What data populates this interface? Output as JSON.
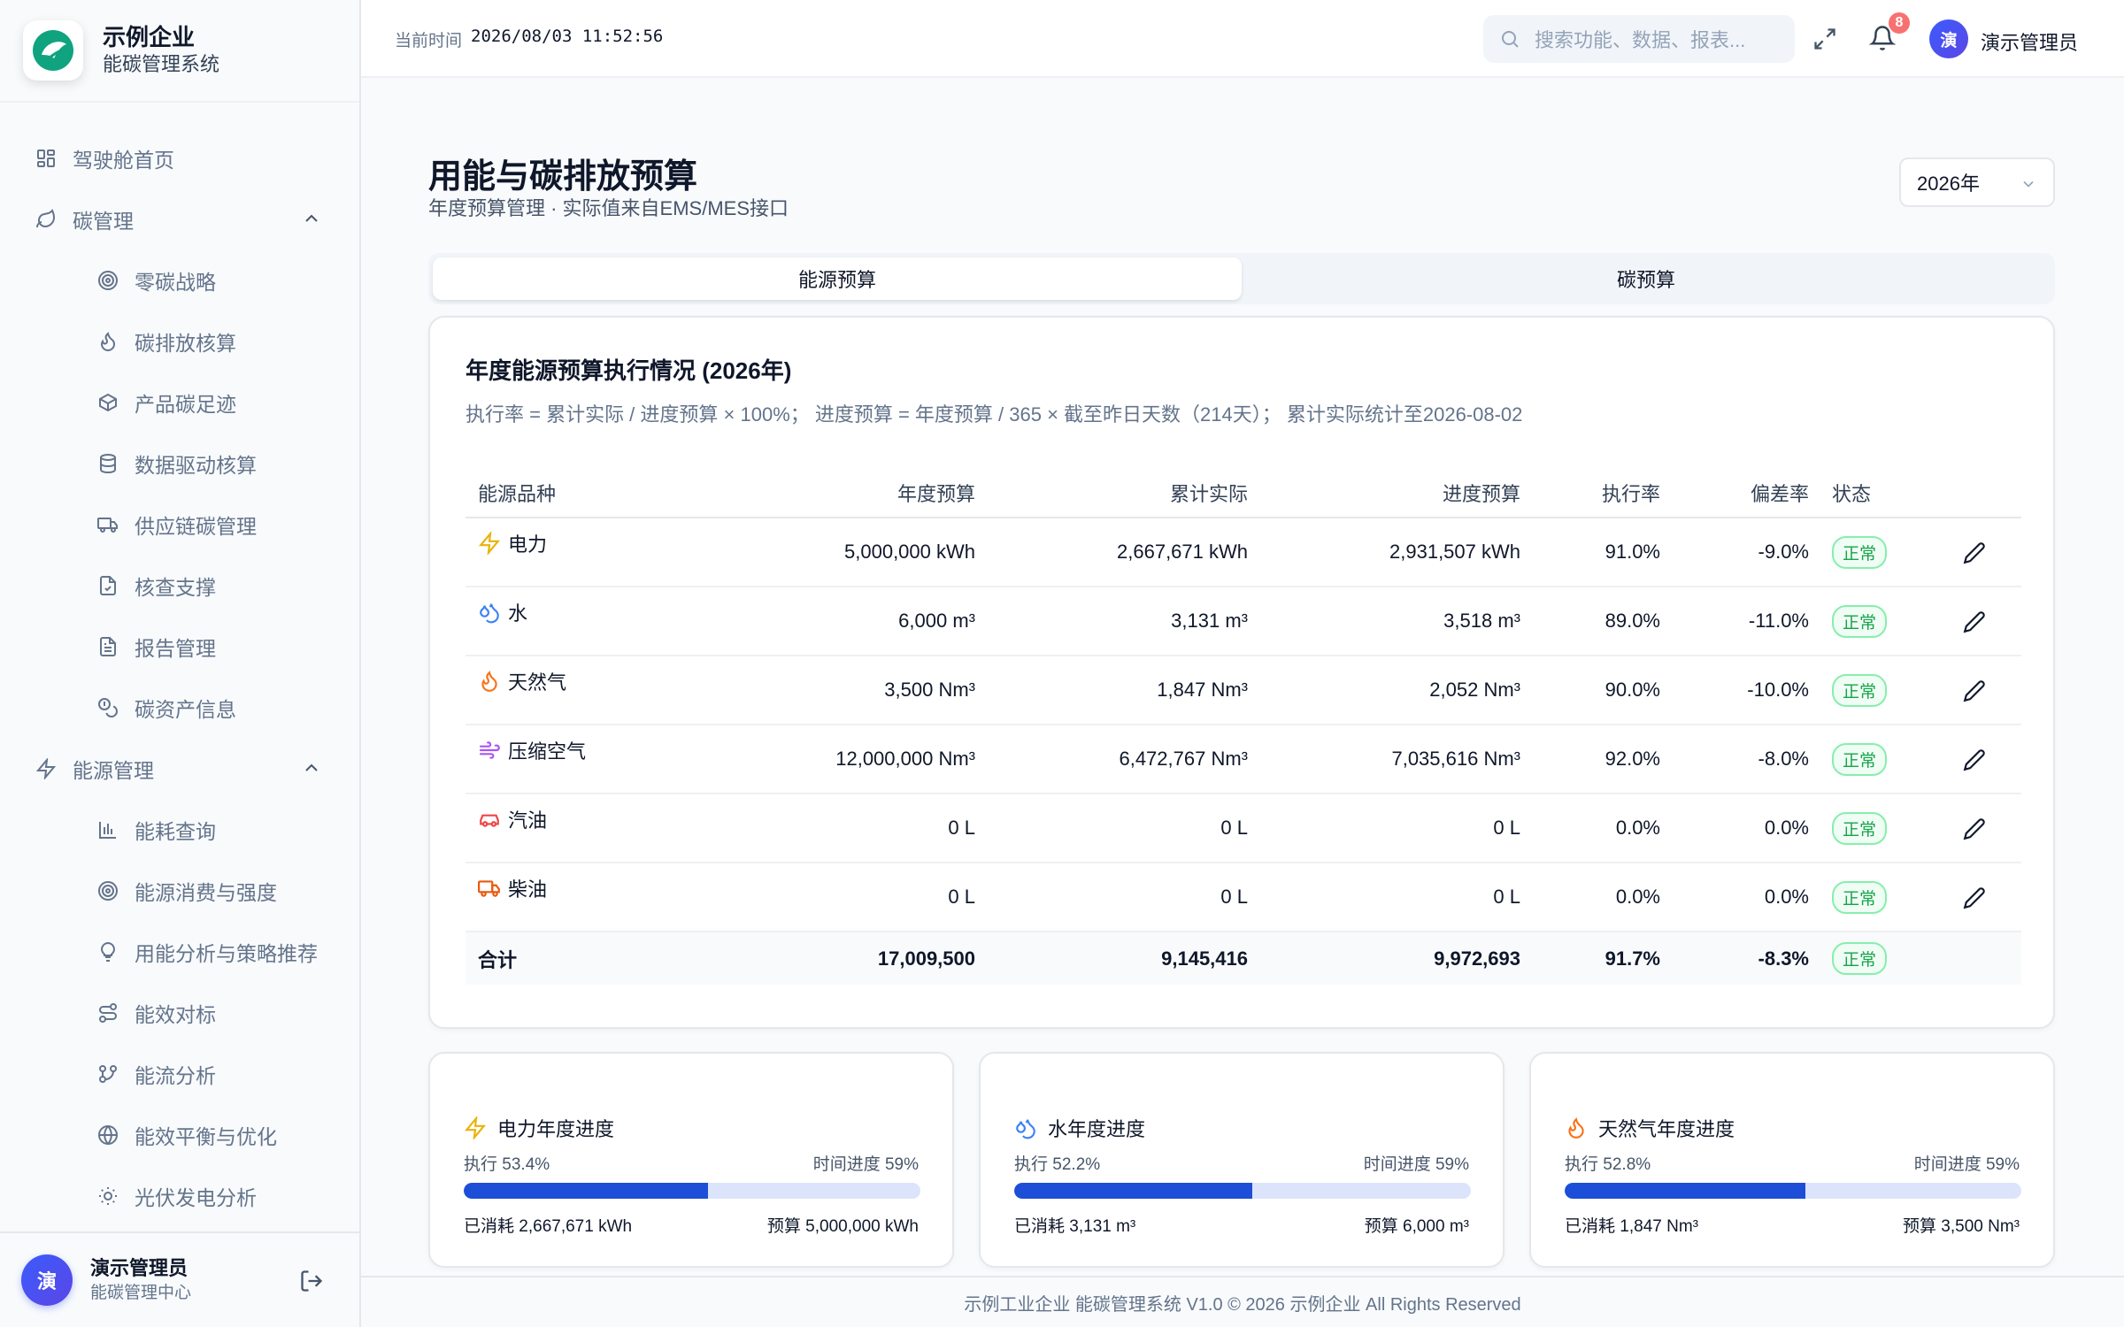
{
  "brand": {
    "name": "示例企业",
    "subtitle": "能碳管理系统"
  },
  "sidebar": {
    "home": "驾驶舱首页",
    "carbon_group": "碳管理",
    "carbon_items": [
      "零碳战略",
      "碳排放核算",
      "产品碳足迹",
      "数据驱动核算",
      "供应链碳管理",
      "核查支撑",
      "报告管理",
      "碳资产信息"
    ],
    "energy_group": "能源管理",
    "energy_items": [
      "能耗查询",
      "能源消费与强度",
      "用能分析与策略推荐",
      "能效对标",
      "能流分析",
      "能效平衡与优化",
      "光伏发电分析"
    ],
    "user": {
      "avatar": "演",
      "name": "演示管理员",
      "role": "能碳管理中心"
    }
  },
  "topbar": {
    "time_label": "当前时间",
    "time_value": "2026/08/03 11:52:56",
    "search_placeholder": "搜索功能、数据、报表...",
    "notifications": "8",
    "avatar": "演",
    "user": "演示管理员"
  },
  "page": {
    "title": "用能与碳排放预算",
    "subtitle": "年度预算管理 · 实际值来自EMS/MES接口",
    "year": "2026年"
  },
  "tabs": [
    "能源预算",
    "碳预算"
  ],
  "budget": {
    "title": "年度能源预算执行情况 (2026年)",
    "formula": "执行率 = 累计实际 / 进度预算 × 100%； 进度预算 = 年度预算 / 365 × 截至昨日天数（214天）； 累计实际统计至2026-08-02",
    "headers": [
      "能源品种",
      "年度预算",
      "累计实际",
      "进度预算",
      "执行率",
      "偏差率",
      "状态"
    ],
    "rows": [
      {
        "name": "电力",
        "icon": "lightning-icon",
        "budget": "5,000,000 kWh",
        "actual": "2,667,671 kWh",
        "progress": "2,931,507 kWh",
        "rate": "91.0%",
        "dev": "-9.0%",
        "status": "正常"
      },
      {
        "name": "水",
        "icon": "droplets-icon",
        "budget": "6,000 m³",
        "actual": "3,131 m³",
        "progress": "3,518 m³",
        "rate": "89.0%",
        "dev": "-11.0%",
        "status": "正常"
      },
      {
        "name": "天然气",
        "icon": "flame-icon",
        "budget": "3,500 Nm³",
        "actual": "1,847 Nm³",
        "progress": "2,052 Nm³",
        "rate": "90.0%",
        "dev": "-10.0%",
        "status": "正常"
      },
      {
        "name": "压缩空气",
        "icon": "wind-icon",
        "budget": "12,000,000 Nm³",
        "actual": "6,472,767 Nm³",
        "progress": "7,035,616 Nm³",
        "rate": "92.0%",
        "dev": "-8.0%",
        "status": "正常"
      },
      {
        "name": "汽油",
        "icon": "car-icon",
        "budget": "0 L",
        "actual": "0 L",
        "progress": "0 L",
        "rate": "0.0%",
        "dev": "0.0%",
        "status": "正常"
      },
      {
        "name": "柴油",
        "icon": "truck-icon",
        "budget": "0 L",
        "actual": "0 L",
        "progress": "0 L",
        "rate": "0.0%",
        "dev": "0.0%",
        "status": "正常"
      }
    ],
    "total": {
      "label": "合计",
      "budget": "17,009,500",
      "actual": "9,145,416",
      "progress": "9,972,693",
      "rate": "91.7%",
      "dev": "-8.3%",
      "status": "正常"
    }
  },
  "progress_cards": [
    {
      "title": "电力年度进度",
      "icon": "lightning-icon",
      "exec": "执行 53.4%",
      "exec_fraction": 0.534,
      "time": "时间进度 59%",
      "used": "已消耗 2,667,671 kWh",
      "budget": "预算 5,000,000 kWh"
    },
    {
      "title": "水年度进度",
      "icon": "droplets-icon",
      "exec": "执行 52.2%",
      "exec_fraction": 0.522,
      "time": "时间进度 59%",
      "used": "已消耗 3,131 m³",
      "budget": "预算 6,000 m³"
    },
    {
      "title": "天然气年度进度",
      "icon": "flame-icon",
      "exec": "执行 52.8%",
      "exec_fraction": 0.528,
      "time": "时间进度 59%",
      "used": "已消耗 1,847 Nm³",
      "budget": "预算 3,500 Nm³"
    }
  ],
  "footer": "示例工业企业 能碳管理系统 V1.0 © 2026 示例企业 All Rights Reserved",
  "colors": {
    "primary": "#1d4ed8",
    "success": "#16a34a",
    "brand": "#10a37f",
    "danger": "#f87171"
  }
}
